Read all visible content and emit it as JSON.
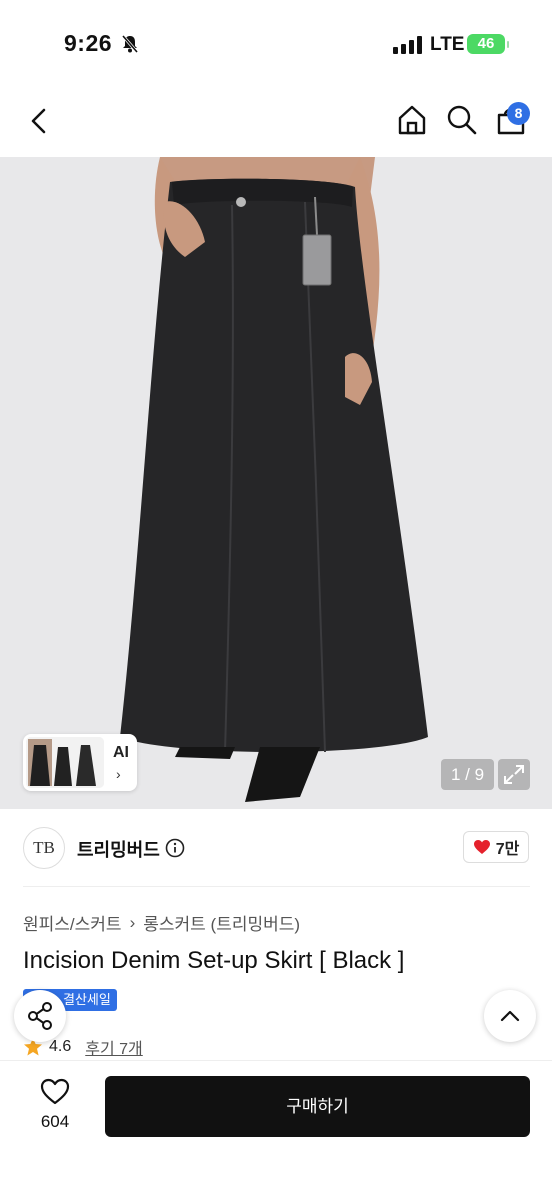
{
  "status_bar": {
    "time": "9:26",
    "network": "LTE",
    "battery": "46"
  },
  "nav": {
    "cart_count": "8"
  },
  "gallery": {
    "ai_label": "AI",
    "ai_chevron": "›",
    "pager": "1 / 9"
  },
  "seller": {
    "logo_text": "TB",
    "name": "트리밍버드",
    "likes": "7만"
  },
  "product": {
    "breadcrumb": [
      "원피스/스커트",
      "롱스커트 (트리밍버드)"
    ],
    "title": "Incision Denim Set-up Skirt [ Black ]",
    "sale_badge": "결산세일",
    "rating": "4.6",
    "reviews": "후기 7개"
  },
  "bottom_bar": {
    "wish_count": "604",
    "buy_label": "구매하기"
  },
  "colors": {
    "accent": "#2f6fe4",
    "heart": "#e5212c",
    "buy_button": "#111111"
  }
}
